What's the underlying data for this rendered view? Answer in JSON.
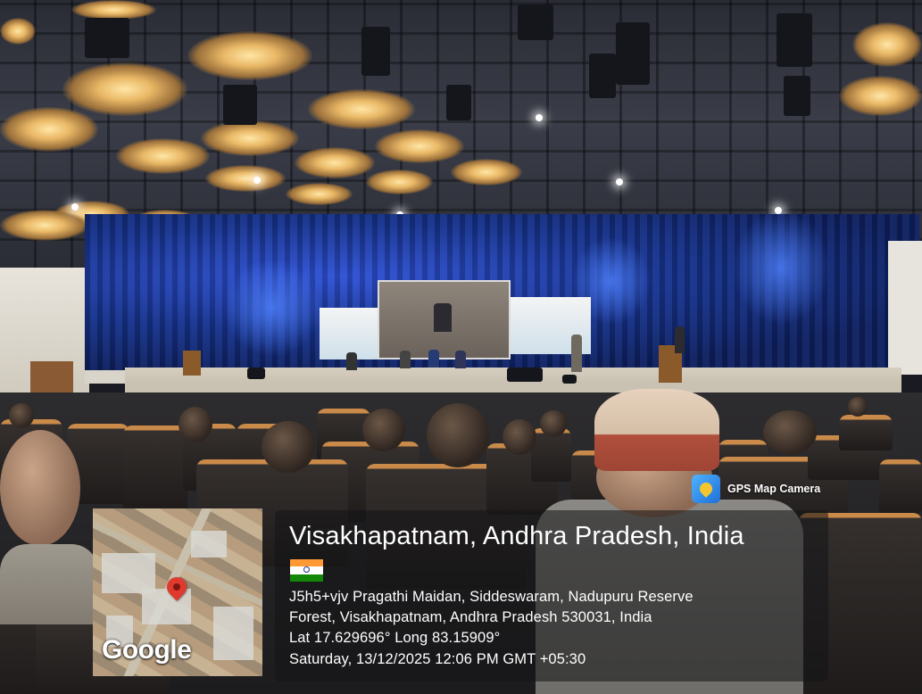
{
  "overlay": {
    "app_name": "GPS Map Camera",
    "location_title": "Visakhapatnam, Andhra Pradesh, India",
    "address_line_1": "J5h5+vjv Pragathi Maidan, Siddeswaram, Nadupuru Reserve",
    "address_line_2": "Forest, Visakhapatnam, Andhra Pradesh 530031, India",
    "coordinates": "Lat 17.629696° Long 83.15909°",
    "datetime": "Saturday, 13/12/2025 12:06 PM GMT +05:30",
    "map_logo": "Google",
    "flag_icon": "india-flag-icon",
    "pin_icon": "map-pin-icon"
  },
  "colors": {
    "curtain": "#12287a",
    "stage_floor": "#d6cfbf",
    "seat_trim": "#c98a4a",
    "map_pin": "#e03a2f"
  }
}
